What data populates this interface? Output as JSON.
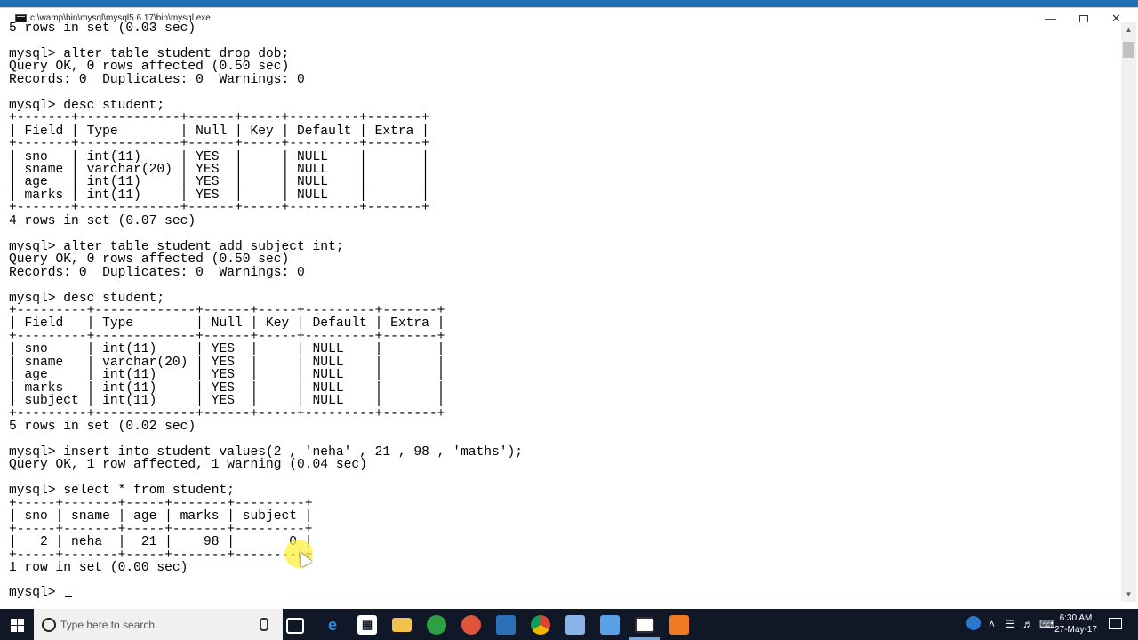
{
  "window": {
    "title": "c:\\wamp\\bin\\mysql\\mysql5.6.17\\bin\\mysql.exe"
  },
  "console": {
    "text": "5 rows in set (0.03 sec)\n\nmysql> alter table student drop dob;\nQuery OK, 0 rows affected (0.50 sec)\nRecords: 0  Duplicates: 0  Warnings: 0\n\nmysql> desc student;\n+-------+-------------+------+-----+---------+-------+\n| Field | Type        | Null | Key | Default | Extra |\n+-------+-------------+------+-----+---------+-------+\n| sno   | int(11)     | YES  |     | NULL    |       |\n| sname | varchar(20) | YES  |     | NULL    |       |\n| age   | int(11)     | YES  |     | NULL    |       |\n| marks | int(11)     | YES  |     | NULL    |       |\n+-------+-------------+------+-----+---------+-------+\n4 rows in set (0.07 sec)\n\nmysql> alter table student add subject int;\nQuery OK, 0 rows affected (0.50 sec)\nRecords: 0  Duplicates: 0  Warnings: 0\n\nmysql> desc student;\n+---------+-------------+------+-----+---------+-------+\n| Field   | Type        | Null | Key | Default | Extra |\n+---------+-------------+------+-----+---------+-------+\n| sno     | int(11)     | YES  |     | NULL    |       |\n| sname   | varchar(20) | YES  |     | NULL    |       |\n| age     | int(11)     | YES  |     | NULL    |       |\n| marks   | int(11)     | YES  |     | NULL    |       |\n| subject | int(11)     | YES  |     | NULL    |       |\n+---------+-------------+------+-----+---------+-------+\n5 rows in set (0.02 sec)\n\nmysql> insert into student values(2 , 'neha' , 21 , 98 , 'maths');\nQuery OK, 1 row affected, 1 warning (0.04 sec)\n\nmysql> select * from student;\n+-----+-------+-----+-------+---------+\n| sno | sname | age | marks | subject |\n+-----+-------+-----+-------+---------+\n|   2 | neha  |  21 |    98 |       0 |\n+-----+-------+-----+-------+---------+\n1 row in set (0.00 sec)\n",
    "prompt": "mysql> "
  },
  "taskbar": {
    "search_placeholder": "Type here to search",
    "time": "6:30 AM",
    "date": "27-May-17",
    "icons": [
      "task-view-icon",
      "edge-icon",
      "store-icon",
      "file-explorer-icon",
      "xbox-icon",
      "app-icon",
      "visual-studio-icon",
      "chrome-icon",
      "box-icon",
      "pen-icon",
      "console-icon",
      "paint-icon"
    ]
  }
}
